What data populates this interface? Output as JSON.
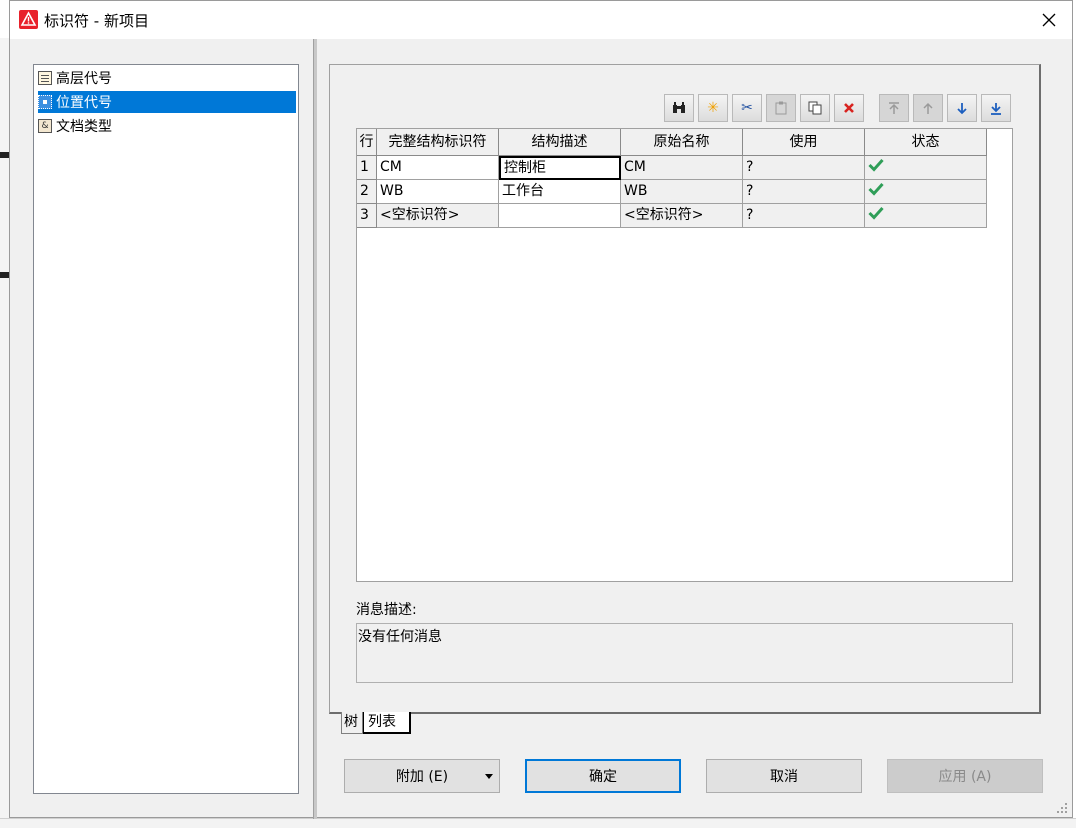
{
  "window": {
    "title": "标识符 - 新项目",
    "app_icon": "warning-triangle-icon",
    "accent": "#0078d7"
  },
  "tree": {
    "items": [
      {
        "label": "高层代号",
        "icon": "list-icon",
        "selected": false
      },
      {
        "label": "位置代号",
        "icon": "location-icon",
        "selected": true
      },
      {
        "label": "文档类型",
        "icon": "document-icon",
        "selected": false
      }
    ]
  },
  "toolbar": {
    "buttons": [
      {
        "icon": "binoculars-icon",
        "enabled": true
      },
      {
        "icon": "new-star-icon",
        "enabled": true
      },
      {
        "icon": "cut-icon",
        "enabled": true
      },
      {
        "icon": "paste-icon",
        "enabled": false
      },
      {
        "icon": "copy-icon",
        "enabled": true
      },
      {
        "icon": "delete-x-icon",
        "enabled": true
      },
      {
        "icon": "move-top-icon",
        "enabled": false
      },
      {
        "icon": "move-up-icon",
        "enabled": false
      },
      {
        "icon": "move-down-icon",
        "enabled": true
      },
      {
        "icon": "move-bottom-icon",
        "enabled": true
      }
    ]
  },
  "grid": {
    "columns": [
      "行",
      "完整结构标识符",
      "结构描述",
      "原始名称",
      "使用",
      "状态"
    ],
    "rows": [
      {
        "num": "1",
        "full_id": "CM",
        "desc": "控制柜",
        "orig": "CM",
        "use": "?",
        "status": "ok"
      },
      {
        "num": "2",
        "full_id": "WB",
        "desc": "工作台",
        "orig": "WB",
        "use": "?",
        "status": "ok"
      },
      {
        "num": "3",
        "full_id": "<空标识符>",
        "desc": "",
        "orig": "<空标识符>",
        "use": "?",
        "status": "ok"
      }
    ]
  },
  "message": {
    "label": "消息描述:",
    "text": "没有任何消息"
  },
  "tabs": [
    {
      "label": "树",
      "active": false
    },
    {
      "label": "列表",
      "active": true
    }
  ],
  "buttons": {
    "add": "附加 (E)",
    "ok": "确定",
    "cancel": "取消",
    "apply": "应用 (A)"
  }
}
